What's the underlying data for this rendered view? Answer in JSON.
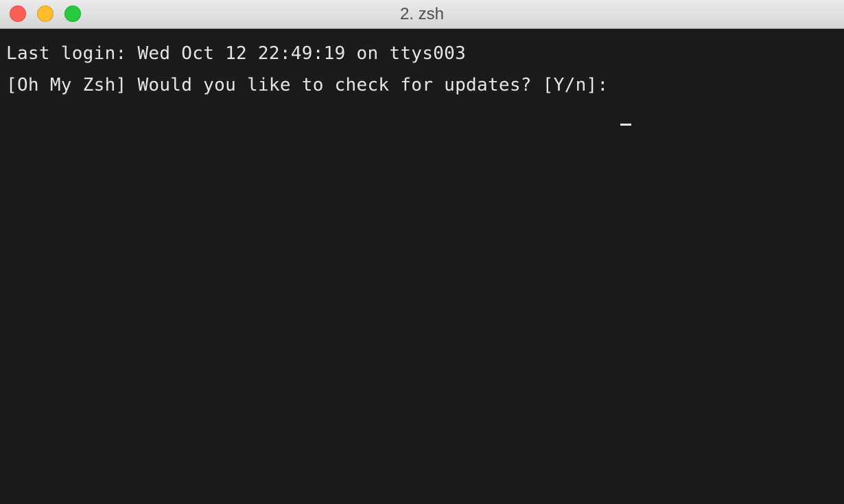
{
  "window": {
    "title": "2. zsh"
  },
  "terminal": {
    "lines": [
      "Last login: Wed Oct 12 22:49:19 on ttys003",
      "[Oh My Zsh] Would you like to check for updates? [Y/n]: "
    ]
  },
  "colors": {
    "terminal_background": "#1b1b1b",
    "terminal_text": "#e6e6e6",
    "close": "#fc5f57",
    "minimize": "#fdbc2e",
    "zoom": "#28c840"
  }
}
